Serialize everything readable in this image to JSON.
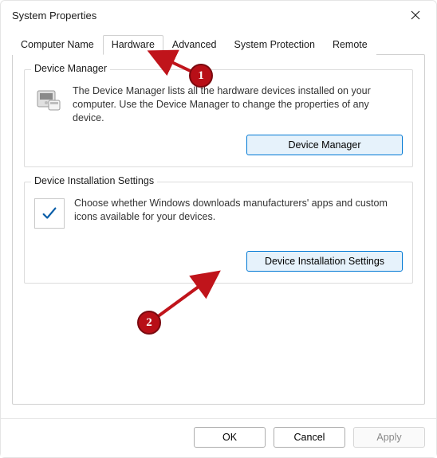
{
  "window": {
    "title": "System Properties"
  },
  "tabs": [
    {
      "label": "Computer Name"
    },
    {
      "label": "Hardware"
    },
    {
      "label": "Advanced"
    },
    {
      "label": "System Protection"
    },
    {
      "label": "Remote"
    }
  ],
  "active_tab_index": 1,
  "device_manager_group": {
    "legend": "Device Manager",
    "description": "The Device Manager lists all the hardware devices installed on your computer. Use the Device Manager to change the properties of any device.",
    "button": "Device Manager"
  },
  "device_install_group": {
    "legend": "Device Installation Settings",
    "description": "Choose whether Windows downloads manufacturers' apps and custom icons available for your devices.",
    "button": "Device Installation Settings"
  },
  "footer": {
    "ok": "OK",
    "cancel": "Cancel",
    "apply": "Apply"
  },
  "annotation": {
    "badge1": "1",
    "badge2": "2",
    "colors": {
      "arrow": "#c0141b",
      "badge_fill": "#b80f17"
    }
  }
}
